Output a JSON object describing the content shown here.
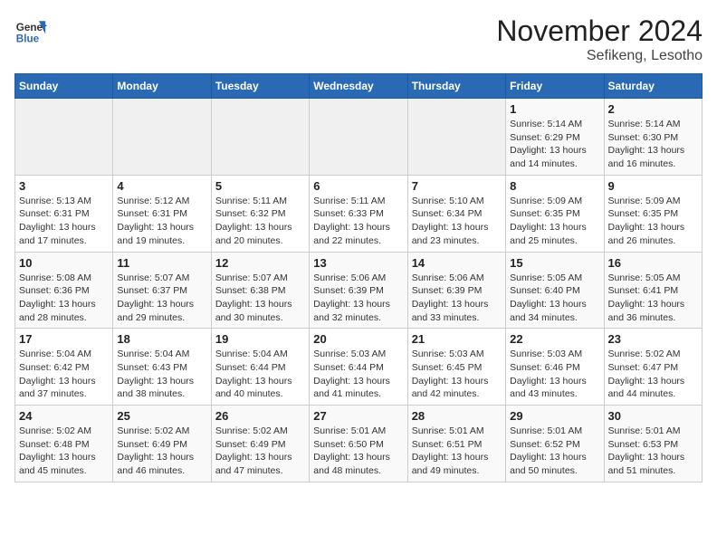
{
  "header": {
    "logo_general": "General",
    "logo_blue": "Blue",
    "month_year": "November 2024",
    "location": "Sefikeng, Lesotho"
  },
  "weekdays": [
    "Sunday",
    "Monday",
    "Tuesday",
    "Wednesday",
    "Thursday",
    "Friday",
    "Saturday"
  ],
  "weeks": [
    [
      {
        "day": "",
        "sunrise": "",
        "sunset": "",
        "daylight": "",
        "empty": true
      },
      {
        "day": "",
        "sunrise": "",
        "sunset": "",
        "daylight": "",
        "empty": true
      },
      {
        "day": "",
        "sunrise": "",
        "sunset": "",
        "daylight": "",
        "empty": true
      },
      {
        "day": "",
        "sunrise": "",
        "sunset": "",
        "daylight": "",
        "empty": true
      },
      {
        "day": "",
        "sunrise": "",
        "sunset": "",
        "daylight": "",
        "empty": true
      },
      {
        "day": "1",
        "sunrise": "Sunrise: 5:14 AM",
        "sunset": "Sunset: 6:29 PM",
        "daylight": "Daylight: 13 hours and 14 minutes.",
        "empty": false
      },
      {
        "day": "2",
        "sunrise": "Sunrise: 5:14 AM",
        "sunset": "Sunset: 6:30 PM",
        "daylight": "Daylight: 13 hours and 16 minutes.",
        "empty": false
      }
    ],
    [
      {
        "day": "3",
        "sunrise": "Sunrise: 5:13 AM",
        "sunset": "Sunset: 6:31 PM",
        "daylight": "Daylight: 13 hours and 17 minutes.",
        "empty": false
      },
      {
        "day": "4",
        "sunrise": "Sunrise: 5:12 AM",
        "sunset": "Sunset: 6:31 PM",
        "daylight": "Daylight: 13 hours and 19 minutes.",
        "empty": false
      },
      {
        "day": "5",
        "sunrise": "Sunrise: 5:11 AM",
        "sunset": "Sunset: 6:32 PM",
        "daylight": "Daylight: 13 hours and 20 minutes.",
        "empty": false
      },
      {
        "day": "6",
        "sunrise": "Sunrise: 5:11 AM",
        "sunset": "Sunset: 6:33 PM",
        "daylight": "Daylight: 13 hours and 22 minutes.",
        "empty": false
      },
      {
        "day": "7",
        "sunrise": "Sunrise: 5:10 AM",
        "sunset": "Sunset: 6:34 PM",
        "daylight": "Daylight: 13 hours and 23 minutes.",
        "empty": false
      },
      {
        "day": "8",
        "sunrise": "Sunrise: 5:09 AM",
        "sunset": "Sunset: 6:35 PM",
        "daylight": "Daylight: 13 hours and 25 minutes.",
        "empty": false
      },
      {
        "day": "9",
        "sunrise": "Sunrise: 5:09 AM",
        "sunset": "Sunset: 6:35 PM",
        "daylight": "Daylight: 13 hours and 26 minutes.",
        "empty": false
      }
    ],
    [
      {
        "day": "10",
        "sunrise": "Sunrise: 5:08 AM",
        "sunset": "Sunset: 6:36 PM",
        "daylight": "Daylight: 13 hours and 28 minutes.",
        "empty": false
      },
      {
        "day": "11",
        "sunrise": "Sunrise: 5:07 AM",
        "sunset": "Sunset: 6:37 PM",
        "daylight": "Daylight: 13 hours and 29 minutes.",
        "empty": false
      },
      {
        "day": "12",
        "sunrise": "Sunrise: 5:07 AM",
        "sunset": "Sunset: 6:38 PM",
        "daylight": "Daylight: 13 hours and 30 minutes.",
        "empty": false
      },
      {
        "day": "13",
        "sunrise": "Sunrise: 5:06 AM",
        "sunset": "Sunset: 6:39 PM",
        "daylight": "Daylight: 13 hours and 32 minutes.",
        "empty": false
      },
      {
        "day": "14",
        "sunrise": "Sunrise: 5:06 AM",
        "sunset": "Sunset: 6:39 PM",
        "daylight": "Daylight: 13 hours and 33 minutes.",
        "empty": false
      },
      {
        "day": "15",
        "sunrise": "Sunrise: 5:05 AM",
        "sunset": "Sunset: 6:40 PM",
        "daylight": "Daylight: 13 hours and 34 minutes.",
        "empty": false
      },
      {
        "day": "16",
        "sunrise": "Sunrise: 5:05 AM",
        "sunset": "Sunset: 6:41 PM",
        "daylight": "Daylight: 13 hours and 36 minutes.",
        "empty": false
      }
    ],
    [
      {
        "day": "17",
        "sunrise": "Sunrise: 5:04 AM",
        "sunset": "Sunset: 6:42 PM",
        "daylight": "Daylight: 13 hours and 37 minutes.",
        "empty": false
      },
      {
        "day": "18",
        "sunrise": "Sunrise: 5:04 AM",
        "sunset": "Sunset: 6:43 PM",
        "daylight": "Daylight: 13 hours and 38 minutes.",
        "empty": false
      },
      {
        "day": "19",
        "sunrise": "Sunrise: 5:04 AM",
        "sunset": "Sunset: 6:44 PM",
        "daylight": "Daylight: 13 hours and 40 minutes.",
        "empty": false
      },
      {
        "day": "20",
        "sunrise": "Sunrise: 5:03 AM",
        "sunset": "Sunset: 6:44 PM",
        "daylight": "Daylight: 13 hours and 41 minutes.",
        "empty": false
      },
      {
        "day": "21",
        "sunrise": "Sunrise: 5:03 AM",
        "sunset": "Sunset: 6:45 PM",
        "daylight": "Daylight: 13 hours and 42 minutes.",
        "empty": false
      },
      {
        "day": "22",
        "sunrise": "Sunrise: 5:03 AM",
        "sunset": "Sunset: 6:46 PM",
        "daylight": "Daylight: 13 hours and 43 minutes.",
        "empty": false
      },
      {
        "day": "23",
        "sunrise": "Sunrise: 5:02 AM",
        "sunset": "Sunset: 6:47 PM",
        "daylight": "Daylight: 13 hours and 44 minutes.",
        "empty": false
      }
    ],
    [
      {
        "day": "24",
        "sunrise": "Sunrise: 5:02 AM",
        "sunset": "Sunset: 6:48 PM",
        "daylight": "Daylight: 13 hours and 45 minutes.",
        "empty": false
      },
      {
        "day": "25",
        "sunrise": "Sunrise: 5:02 AM",
        "sunset": "Sunset: 6:49 PM",
        "daylight": "Daylight: 13 hours and 46 minutes.",
        "empty": false
      },
      {
        "day": "26",
        "sunrise": "Sunrise: 5:02 AM",
        "sunset": "Sunset: 6:49 PM",
        "daylight": "Daylight: 13 hours and 47 minutes.",
        "empty": false
      },
      {
        "day": "27",
        "sunrise": "Sunrise: 5:01 AM",
        "sunset": "Sunset: 6:50 PM",
        "daylight": "Daylight: 13 hours and 48 minutes.",
        "empty": false
      },
      {
        "day": "28",
        "sunrise": "Sunrise: 5:01 AM",
        "sunset": "Sunset: 6:51 PM",
        "daylight": "Daylight: 13 hours and 49 minutes.",
        "empty": false
      },
      {
        "day": "29",
        "sunrise": "Sunrise: 5:01 AM",
        "sunset": "Sunset: 6:52 PM",
        "daylight": "Daylight: 13 hours and 50 minutes.",
        "empty": false
      },
      {
        "day": "30",
        "sunrise": "Sunrise: 5:01 AM",
        "sunset": "Sunset: 6:53 PM",
        "daylight": "Daylight: 13 hours and 51 minutes.",
        "empty": false
      }
    ]
  ]
}
